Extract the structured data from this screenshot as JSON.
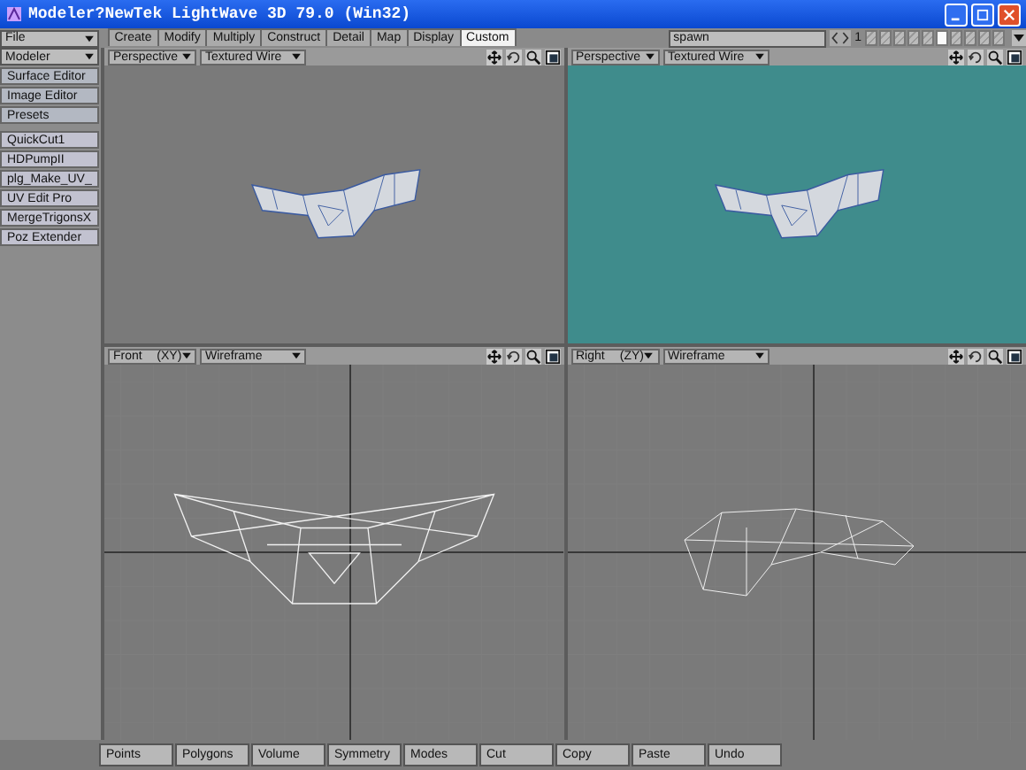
{
  "window": {
    "title": "Modeler?NewTek LightWave 3D 79.0 (Win32)"
  },
  "menu_dropdowns": [
    {
      "label": "File"
    },
    {
      "label": "Modeler"
    }
  ],
  "tabs": [
    {
      "label": "Create",
      "selected": false
    },
    {
      "label": "Modify",
      "selected": false
    },
    {
      "label": "Multiply",
      "selected": false
    },
    {
      "label": "Construct",
      "selected": false
    },
    {
      "label": "Detail",
      "selected": false
    },
    {
      "label": "Map",
      "selected": false
    },
    {
      "label": "Display",
      "selected": false
    },
    {
      "label": "Custom",
      "selected": true
    }
  ],
  "object_dropdown": {
    "value": "spawn"
  },
  "layer_page": "1",
  "layers": [
    {
      "selected": false
    },
    {
      "selected": false
    },
    {
      "selected": false
    },
    {
      "selected": false
    },
    {
      "selected": false
    },
    {
      "selected": true
    },
    {
      "selected": false
    },
    {
      "selected": false
    },
    {
      "selected": false
    },
    {
      "selected": false
    }
  ],
  "sidebar_buttons": [
    {
      "label": "Surface Editor",
      "kind": "editor"
    },
    {
      "label": "Image Editor",
      "kind": "editor"
    },
    {
      "label": "Presets",
      "kind": "editor"
    },
    {
      "label": "QuickCut1",
      "kind": "plugin"
    },
    {
      "label": "HDPumpII",
      "kind": "plugin"
    },
    {
      "label": "plg_Make_UV_",
      "kind": "plugin"
    },
    {
      "label": "UV Edit Pro",
      "kind": "plugin"
    },
    {
      "label": "MergeTrigonsX",
      "kind": "plugin"
    },
    {
      "label": "Poz Extender",
      "kind": "plugin"
    }
  ],
  "viewports": [
    {
      "view": "Perspective",
      "mode": "Textured Wire",
      "kind": "perspective",
      "selected": false
    },
    {
      "view": "Perspective",
      "mode": "Textured Wire",
      "kind": "perspective",
      "selected": true
    },
    {
      "view": "Front",
      "axes": "(XY)",
      "mode": "Wireframe",
      "kind": "front",
      "selected": false
    },
    {
      "view": "Right",
      "axes": "(ZY)",
      "mode": "Wireframe",
      "kind": "right",
      "selected": false
    }
  ],
  "bottom_bar": [
    "Points",
    "Polygons",
    "Volume",
    "Symmetry",
    "Modes",
    "Cut",
    "Copy",
    "Paste",
    "Undo"
  ]
}
